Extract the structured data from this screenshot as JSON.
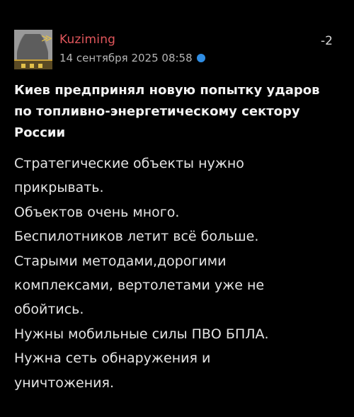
{
  "post": {
    "author": {
      "username": "Kuziming",
      "avatar_icon": "soldier-silhouette-avatar",
      "rank_icon": "chevron-rank-icon"
    },
    "timestamp": "14 сентября 2025 08:58",
    "online_indicator_color": "#2f8de4",
    "score": "-2",
    "title": "Киев предпринял новую попытку ударов по топливно-энергетическому сектору России",
    "body_lines": [
      "Стратегические объекты нужно",
      "прикрывать.",
      "Объектов очень много.",
      "Беспилотников летит всё больше.",
      "Старыми методами,дорогими",
      "комплексами, вертолетами уже не",
      "обойтись.",
      "Нужны мобильные силы ПВО БПЛА.",
      "Нужна сеть обнаружения и",
      "уничтожения."
    ]
  },
  "colors": {
    "background": "#000000",
    "username": "#e0565b",
    "text": "#e4e4e4",
    "muted": "#b4b4b4"
  }
}
